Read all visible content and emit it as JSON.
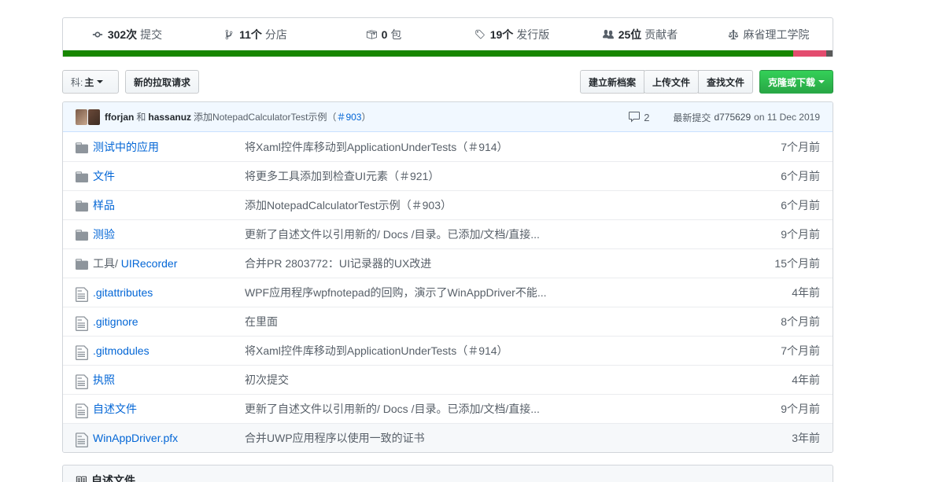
{
  "summary": {
    "commits": {
      "num": "302次",
      "label": "提交"
    },
    "branches": {
      "num": "11个",
      "label": "分店"
    },
    "packages": {
      "num": "0",
      "label": "包"
    },
    "releases": {
      "num": "19个",
      "label": "发行版"
    },
    "contributors": {
      "num": "25位",
      "label": "贡献者"
    },
    "license": {
      "label": "麻省理工学院"
    }
  },
  "language_bar": {
    "colors": [
      "#178600",
      "#e34c6e",
      "#5a5a5a"
    ],
    "fractions": [
      0.944,
      0.043,
      0.008
    ]
  },
  "toolbar": {
    "branch_prefix": "科:",
    "branch_name": "主",
    "pull_request": "新的拉取请求",
    "create_file": "建立新档案",
    "upload_files": "上传文件",
    "find_file": "查找文件",
    "clone_download": "克隆或下载"
  },
  "commit": {
    "author1": "fforjan",
    "and": "和",
    "author2": "hassanuz",
    "message": "添加NotepadCalculatorTest示例（",
    "issue": "＃903",
    "message_end": "）",
    "comments": "2",
    "latest_label": "最新提交",
    "sha": "d775629",
    "date": "on 11 Dec 2019"
  },
  "files": [
    {
      "type": "dir",
      "name": "测试中的应用",
      "message": "将Xaml控件库移动到ApplicationUnderTests（＃914）",
      "age": "7个月前"
    },
    {
      "type": "dir",
      "name": "文件",
      "message": "将更多工具添加到检查UI元素（＃921）",
      "age": "6个月前"
    },
    {
      "type": "dir",
      "name": "样品",
      "message": "添加NotepadCalculatorTest示例（＃903）",
      "age": "6个月前"
    },
    {
      "type": "dir",
      "name": "测验",
      "message": "更新了自述文件以引用新的/ Docs /目录。已添加/文档/直接...",
      "age": "9个月前"
    },
    {
      "type": "dir",
      "name_prefix": "工具/ ",
      "name": "UIRecorder",
      "message": "合并PR 2803772：UI记录器的UX改进",
      "age": "15个月前"
    },
    {
      "type": "file",
      "name": ".gitattributes",
      "message": "WPF应用程序wpfnotepad的回购，演示了WinAppDriver不能...",
      "age": "4年前"
    },
    {
      "type": "file",
      "name": ".gitignore",
      "message": "在里面",
      "age": "8个月前"
    },
    {
      "type": "file",
      "name": ".gitmodules",
      "message": "将Xaml控件库移动到ApplicationUnderTests（＃914）",
      "age": "7个月前"
    },
    {
      "type": "file",
      "name": "执照",
      "message": "初次提交",
      "age": "4年前"
    },
    {
      "type": "file",
      "name": "自述文件",
      "message": "更新了自述文件以引用新的/ Docs /目录。已添加/文档/直接...",
      "age": "9个月前"
    },
    {
      "type": "file",
      "name": "WinAppDriver.pfx",
      "message": "合并UWP应用程序以使用一致的证书",
      "age": "3年前"
    }
  ],
  "readme": {
    "title": "自述文件"
  },
  "colors": {
    "link": "#0366d6",
    "muted": "#586069",
    "green": "#28a745",
    "icon": "#6a737d"
  }
}
